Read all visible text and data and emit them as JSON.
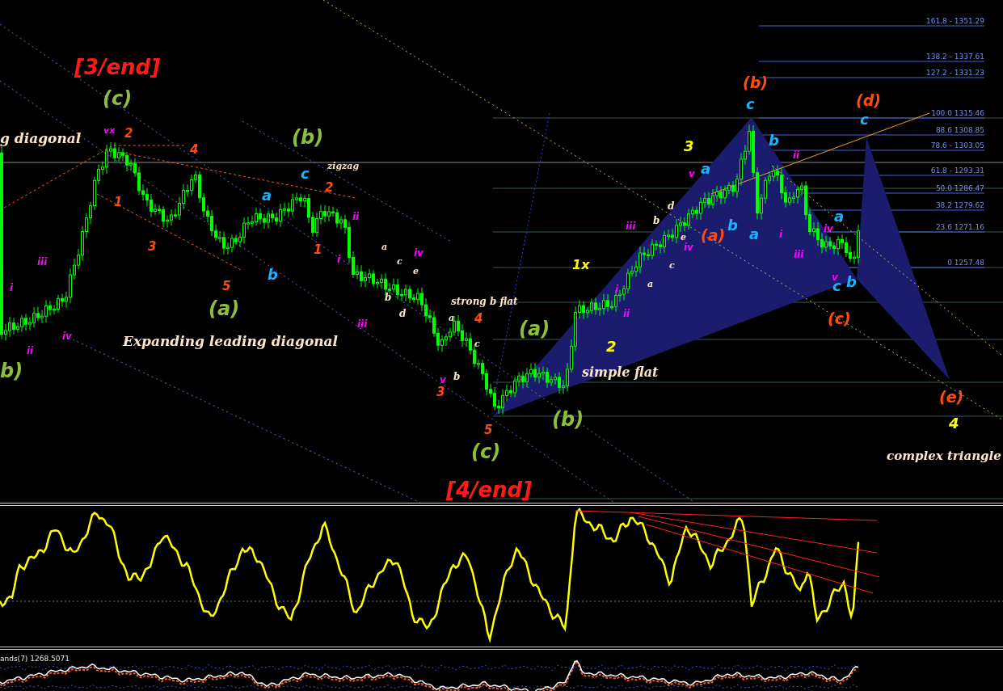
{
  "main_chart": {
    "fib_levels": [
      {
        "label": "161.8 -  1351.29"
      },
      {
        "label": "138.2 - 1337.61"
      },
      {
        "label": "127.2 - 1331.23"
      },
      {
        "label": "100.0 1315.46"
      },
      {
        "label": "88.6 1308.85"
      },
      {
        "label": "78.6 - 1303.05"
      },
      {
        "label": "61.8 - 1293.31"
      },
      {
        "label": "50.0 1286.47"
      },
      {
        "label": "38.2 1279.62"
      },
      {
        "label": "23.6 1271.16"
      },
      {
        "label": "0 1257.48"
      }
    ],
    "wave_labels": [
      {
        "text": "[3/end]",
        "color": "#ff1a1a"
      },
      {
        "text": "[4/end]",
        "color": "#ff1a1a"
      },
      {
        "text": "(c)",
        "color": "#8fbf3a"
      },
      {
        "text": "(b)",
        "color": "#8fbf3a"
      },
      {
        "text": "(a)",
        "color": "#8fbf3a"
      },
      {
        "text": "(a)",
        "color": "#8fbf3a"
      },
      {
        "text": "(b)",
        "color": "#8fbf3a"
      },
      {
        "text": "(c)",
        "color": "#8fbf3a"
      },
      {
        "text": "b)",
        "color": "#8fbf3a"
      },
      {
        "text": "2",
        "color": "#ff4a10"
      },
      {
        "text": "4",
        "color": "#ff4a10"
      },
      {
        "text": "1",
        "color": "#ff4a10"
      },
      {
        "text": "3",
        "color": "#ff4a10"
      },
      {
        "text": "5",
        "color": "#ff4a10"
      },
      {
        "text": "2",
        "color": "#ff4a10"
      },
      {
        "text": "1",
        "color": "#ff4a10"
      },
      {
        "text": "4",
        "color": "#ff4a10"
      },
      {
        "text": "3",
        "color": "#ff4a10"
      },
      {
        "text": "5",
        "color": "#ff4a10"
      },
      {
        "text": "(b)",
        "color": "#ff4a10"
      },
      {
        "text": "(d)",
        "color": "#ff4a10"
      },
      {
        "text": "(c)",
        "color": "#ff4a10"
      },
      {
        "text": "(a)",
        "color": "#ff4a10"
      },
      {
        "text": "(e)",
        "color": "#ff4a10"
      },
      {
        "text": "vx",
        "color": "#ff00ff"
      },
      {
        "text": "iii",
        "color": "#ff00ff"
      },
      {
        "text": "i",
        "color": "#ff00ff"
      },
      {
        "text": "ii",
        "color": "#ff00ff"
      },
      {
        "text": "iv",
        "color": "#ff00ff"
      },
      {
        "text": "ii",
        "color": "#ff00ff"
      },
      {
        "text": "i",
        "color": "#ff00ff"
      },
      {
        "text": "iii",
        "color": "#ff00ff"
      },
      {
        "text": "iv",
        "color": "#ff00ff"
      },
      {
        "text": "v",
        "color": "#ff00ff"
      },
      {
        "text": "i",
        "color": "#ff00ff"
      },
      {
        "text": "ii",
        "color": "#ff00ff"
      },
      {
        "text": "iii",
        "color": "#ff00ff"
      },
      {
        "text": "v",
        "color": "#ff00ff"
      },
      {
        "text": "iv",
        "color": "#ff00ff"
      },
      {
        "text": "ii",
        "color": "#ff00ff"
      },
      {
        "text": "i",
        "color": "#ff00ff"
      },
      {
        "text": "iii",
        "color": "#ff00ff"
      },
      {
        "text": "iv",
        "color": "#ff00ff"
      },
      {
        "text": "v",
        "color": "#ff00ff"
      },
      {
        "text": "c",
        "color": "#18b4ff"
      },
      {
        "text": "a",
        "color": "#18b4ff"
      },
      {
        "text": "b",
        "color": "#18b4ff"
      },
      {
        "text": "c",
        "color": "#18b4ff"
      },
      {
        "text": "b",
        "color": "#18b4ff"
      },
      {
        "text": "a",
        "color": "#18b4ff"
      },
      {
        "text": "b",
        "color": "#18b4ff"
      },
      {
        "text": "a",
        "color": "#18b4ff"
      },
      {
        "text": "a",
        "color": "#18b4ff"
      },
      {
        "text": "c",
        "color": "#18b4ff"
      },
      {
        "text": "b",
        "color": "#18b4ff"
      },
      {
        "text": "c",
        "color": "#18b4ff"
      },
      {
        "text": "3",
        "color": "#ffff00"
      },
      {
        "text": "1x",
        "color": "#ffff00"
      },
      {
        "text": "2",
        "color": "#ffff00"
      },
      {
        "text": "4",
        "color": "#ffff00"
      }
    ],
    "comments": [
      {
        "text": "g diagonal"
      },
      {
        "text": "Expanding leading diagonal"
      },
      {
        "text": "zigzag"
      },
      {
        "text": "a"
      },
      {
        "text": "c"
      },
      {
        "text": "e"
      },
      {
        "text": "b"
      },
      {
        "text": "d"
      },
      {
        "text": "strong b flat"
      },
      {
        "text": "a"
      },
      {
        "text": "c"
      },
      {
        "text": "b"
      },
      {
        "text": "a"
      },
      {
        "text": "c"
      },
      {
        "text": "e"
      },
      {
        "text": "b"
      },
      {
        "text": "d"
      },
      {
        "text": "simple flat"
      },
      {
        "text": "complex triangle"
      }
    ]
  },
  "bands_panel": {
    "label": "ands(7) 1268.5071"
  }
}
